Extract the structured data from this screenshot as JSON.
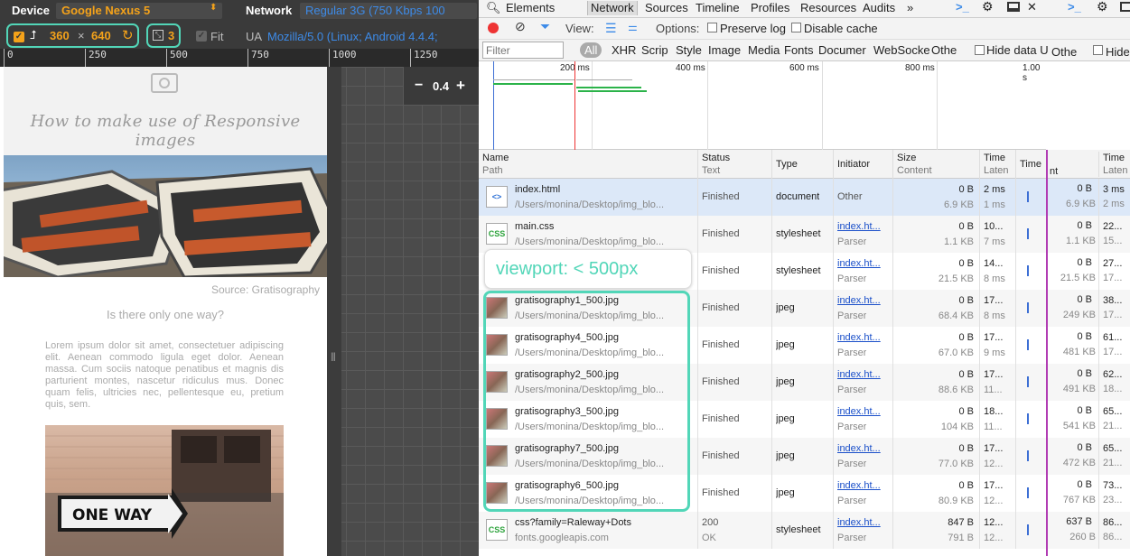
{
  "emulator": {
    "device_label": "Device",
    "device_value": "Google Nexus 5",
    "network_label": "Network",
    "network_value": "Regular 3G (750 Kbps 100",
    "width": "360",
    "times": "×",
    "height": "640",
    "dpr": "3",
    "fit_label": "Fit",
    "ua_label": "UA",
    "ua_value": "Mozilla/5.0 (Linux; Android 4.4.4;",
    "ruler_ticks": [
      "0",
      "250",
      "500",
      "750",
      "1000",
      "1250"
    ],
    "zoom_minus": "−",
    "zoom_value": "0.4",
    "zoom_plus": "+"
  },
  "page": {
    "title": "How to make use of Responsive images",
    "caption": "Source: Gratisography",
    "subtitle": "Is there only one way?",
    "body": "Lorem ipsum dolor sit amet, consectetuer adipiscing elit. Aenean commodo ligula eget dolor. Aenean massa. Cum sociis natoque penatibus et magnis dis parturient montes, nascetur ridiculus mus. Donec quam felis, ultricies nec, pellentesque eu, pretium quis, sem.",
    "sign_text": "ONE WAY"
  },
  "devtools": {
    "tabs": [
      "Elements",
      "Network",
      "Sources",
      "Timeline",
      "Profiles",
      "Resources",
      "Audits"
    ],
    "more": "»",
    "view_label": "View:",
    "options_label": "Options:",
    "preserve_log": "Preserve log",
    "disable_cache": "Disable cache",
    "filter_placeholder": "Filter",
    "filter_types": [
      "All",
      "XHR",
      "Scrip",
      "Style",
      "Image",
      "Media",
      "Fonts",
      "Documer",
      "WebSocke",
      "Othe"
    ],
    "hide_data": "Hide data U",
    "right_other": "Othe",
    "right_hide": "Hide",
    "timeline_ticks": [
      "200 ms",
      "400 ms",
      "600 ms",
      "800 ms",
      "1.00 s"
    ],
    "columns": {
      "name": "Name",
      "path": "Path",
      "status": "Status",
      "text": "Text",
      "type": "Type",
      "initiator": "Initiator",
      "size": "Size",
      "content": "Content",
      "time": "Time",
      "latency": "Laten",
      "timeline": "Time"
    },
    "right_columns": {
      "content": "nt",
      "time": "Time",
      "latency": "Laten"
    },
    "rows": [
      {
        "name": "index.html",
        "path": "/Users/monina/Desktop/img_blo...",
        "status": "Finished",
        "status2": "",
        "type": "document",
        "initiator": "Other",
        "initiator2": "",
        "size": "0 B",
        "content": "6.9 KB",
        "time": "2 ms",
        "latency": "1 ms",
        "icon": "html-file-icon",
        "r_size": "0 B",
        "r_content": "6.9 KB",
        "r_time": "3 ms",
        "r_lat": "2 ms"
      },
      {
        "name": "main.css",
        "path": "/Users/monina/Desktop/img_blo...",
        "status": "Finished",
        "status2": "",
        "type": "stylesheet",
        "initiator": "index.ht...",
        "initiator2": "Parser",
        "size": "0 B",
        "content": "1.1 KB",
        "time": "10...",
        "latency": "7 ms",
        "icon": "css-file-icon",
        "r_size": "0 B",
        "r_content": "1.1 KB",
        "r_time": "22...",
        "r_lat": "15..."
      },
      {
        "name": "",
        "path": "",
        "status": "Finished",
        "status2": "",
        "type": "stylesheet",
        "initiator": "index.ht...",
        "initiator2": "Parser",
        "size": "0 B",
        "content": "21.5 KB",
        "time": "14...",
        "latency": "8 ms",
        "icon": "css-file-icon",
        "r_size": "0 B",
        "r_content": "21.5 KB",
        "r_time": "27...",
        "r_lat": "17..."
      },
      {
        "name": "gratisography1_500.jpg",
        "path": "/Users/monina/Desktop/img_blo...",
        "status": "Finished",
        "status2": "",
        "type": "jpeg",
        "initiator": "index.ht...",
        "initiator2": "Parser",
        "size": "0 B",
        "content": "68.4 KB",
        "time": "17...",
        "latency": "8 ms",
        "icon": "image-file-icon",
        "r_size": "0 B",
        "r_content": "249 KB",
        "r_time": "38...",
        "r_lat": "17..."
      },
      {
        "name": "gratisography4_500.jpg",
        "path": "/Users/monina/Desktop/img_blo...",
        "status": "Finished",
        "status2": "",
        "type": "jpeg",
        "initiator": "index.ht...",
        "initiator2": "Parser",
        "size": "0 B",
        "content": "67.0 KB",
        "time": "17...",
        "latency": "9 ms",
        "icon": "image-file-icon",
        "r_size": "0 B",
        "r_content": "481 KB",
        "r_time": "61...",
        "r_lat": "17..."
      },
      {
        "name": "gratisography2_500.jpg",
        "path": "/Users/monina/Desktop/img_blo...",
        "status": "Finished",
        "status2": "",
        "type": "jpeg",
        "initiator": "index.ht...",
        "initiator2": "Parser",
        "size": "0 B",
        "content": "88.6 KB",
        "time": "17...",
        "latency": "11...",
        "icon": "image-file-icon",
        "r_size": "0 B",
        "r_content": "491 KB",
        "r_time": "62...",
        "r_lat": "18..."
      },
      {
        "name": "gratisography3_500.jpg",
        "path": "/Users/monina/Desktop/img_blo...",
        "status": "Finished",
        "status2": "",
        "type": "jpeg",
        "initiator": "index.ht...",
        "initiator2": "Parser",
        "size": "0 B",
        "content": "104 KB",
        "time": "18...",
        "latency": "11...",
        "icon": "image-file-icon",
        "r_size": "0 B",
        "r_content": "541 KB",
        "r_time": "65...",
        "r_lat": "21..."
      },
      {
        "name": "gratisography7_500.jpg",
        "path": "/Users/monina/Desktop/img_blo...",
        "status": "Finished",
        "status2": "",
        "type": "jpeg",
        "initiator": "index.ht...",
        "initiator2": "Parser",
        "size": "0 B",
        "content": "77.0 KB",
        "time": "17...",
        "latency": "12...",
        "icon": "image-file-icon",
        "r_size": "0 B",
        "r_content": "472 KB",
        "r_time": "65...",
        "r_lat": "21..."
      },
      {
        "name": "gratisography6_500.jpg",
        "path": "/Users/monina/Desktop/img_blo...",
        "status": "Finished",
        "status2": "",
        "type": "jpeg",
        "initiator": "index.ht...",
        "initiator2": "Parser",
        "size": "0 B",
        "content": "80.9 KB",
        "time": "17...",
        "latency": "12...",
        "icon": "image-file-icon",
        "r_size": "0 B",
        "r_content": "767 KB",
        "r_time": "73...",
        "r_lat": "23..."
      },
      {
        "name": "css?family=Raleway+Dots",
        "path": "fonts.googleapis.com",
        "status": "200",
        "status2": "OK",
        "type": "stylesheet",
        "initiator": "index.ht...",
        "initiator2": "Parser",
        "size": "847 B",
        "content": "791 B",
        "time": "12...",
        "latency": "12...",
        "icon": "css-file-icon",
        "r_size": "637 B",
        "r_content": "260 B",
        "r_time": "86...",
        "r_lat": "86..."
      }
    ]
  },
  "annotation": {
    "viewport": "viewport: < 500px"
  },
  "colors": {
    "highlight": "#52d6b8",
    "accent": "#f4a21a",
    "link": "#3d8be8"
  }
}
